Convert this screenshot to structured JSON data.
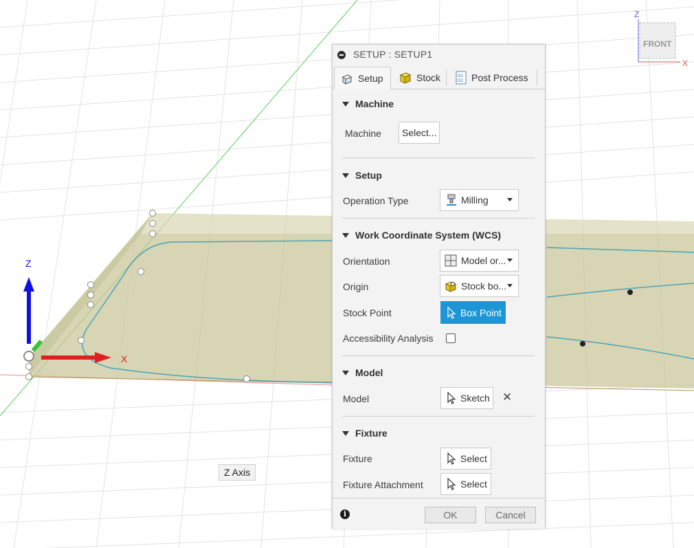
{
  "viewport": {
    "axis_tooltip": "Z Axis",
    "axis_labels": {
      "x": "X",
      "z": "Z"
    },
    "view_cube": {
      "face_label": "FRONT",
      "z_label": "Z",
      "x_label": "X"
    }
  },
  "dialog": {
    "title": "SETUP : SETUP1",
    "tabs": [
      {
        "label": "Setup",
        "icon": "setup-icon",
        "active": true
      },
      {
        "label": "Stock",
        "icon": "stock-cube-icon",
        "active": false
      },
      {
        "label": "Post Process",
        "icon": "post-process-icon",
        "active": false
      }
    ],
    "sections": {
      "machine": {
        "title": "Machine",
        "machine_label": "Machine",
        "machine_button": "Select..."
      },
      "setup": {
        "title": "Setup",
        "operation_type_label": "Operation Type",
        "operation_type_value": "Milling"
      },
      "wcs": {
        "title": "Work Coordinate System (WCS)",
        "orientation_label": "Orientation",
        "orientation_value": "Model or...",
        "origin_label": "Origin",
        "origin_value": "Stock bo...",
        "stock_point_label": "Stock Point",
        "stock_point_value": "Box Point",
        "accessibility_label": "Accessibility Analysis",
        "accessibility_checked": false
      },
      "model": {
        "title": "Model",
        "model_label": "Model",
        "model_value": "Sketch"
      },
      "fixture": {
        "title": "Fixture",
        "fixture_label": "Fixture",
        "fixture_value": "Select",
        "attachment_label": "Fixture Attachment",
        "attachment_value": "Select"
      }
    },
    "footer": {
      "ok": "OK",
      "cancel": "Cancel"
    }
  },
  "colors": {
    "accent": "#1e96d6",
    "stock": "#c9c79a",
    "x_axis": "#e02020",
    "z_axis": "#1010e0",
    "toolpath": "#4aa3b8"
  }
}
